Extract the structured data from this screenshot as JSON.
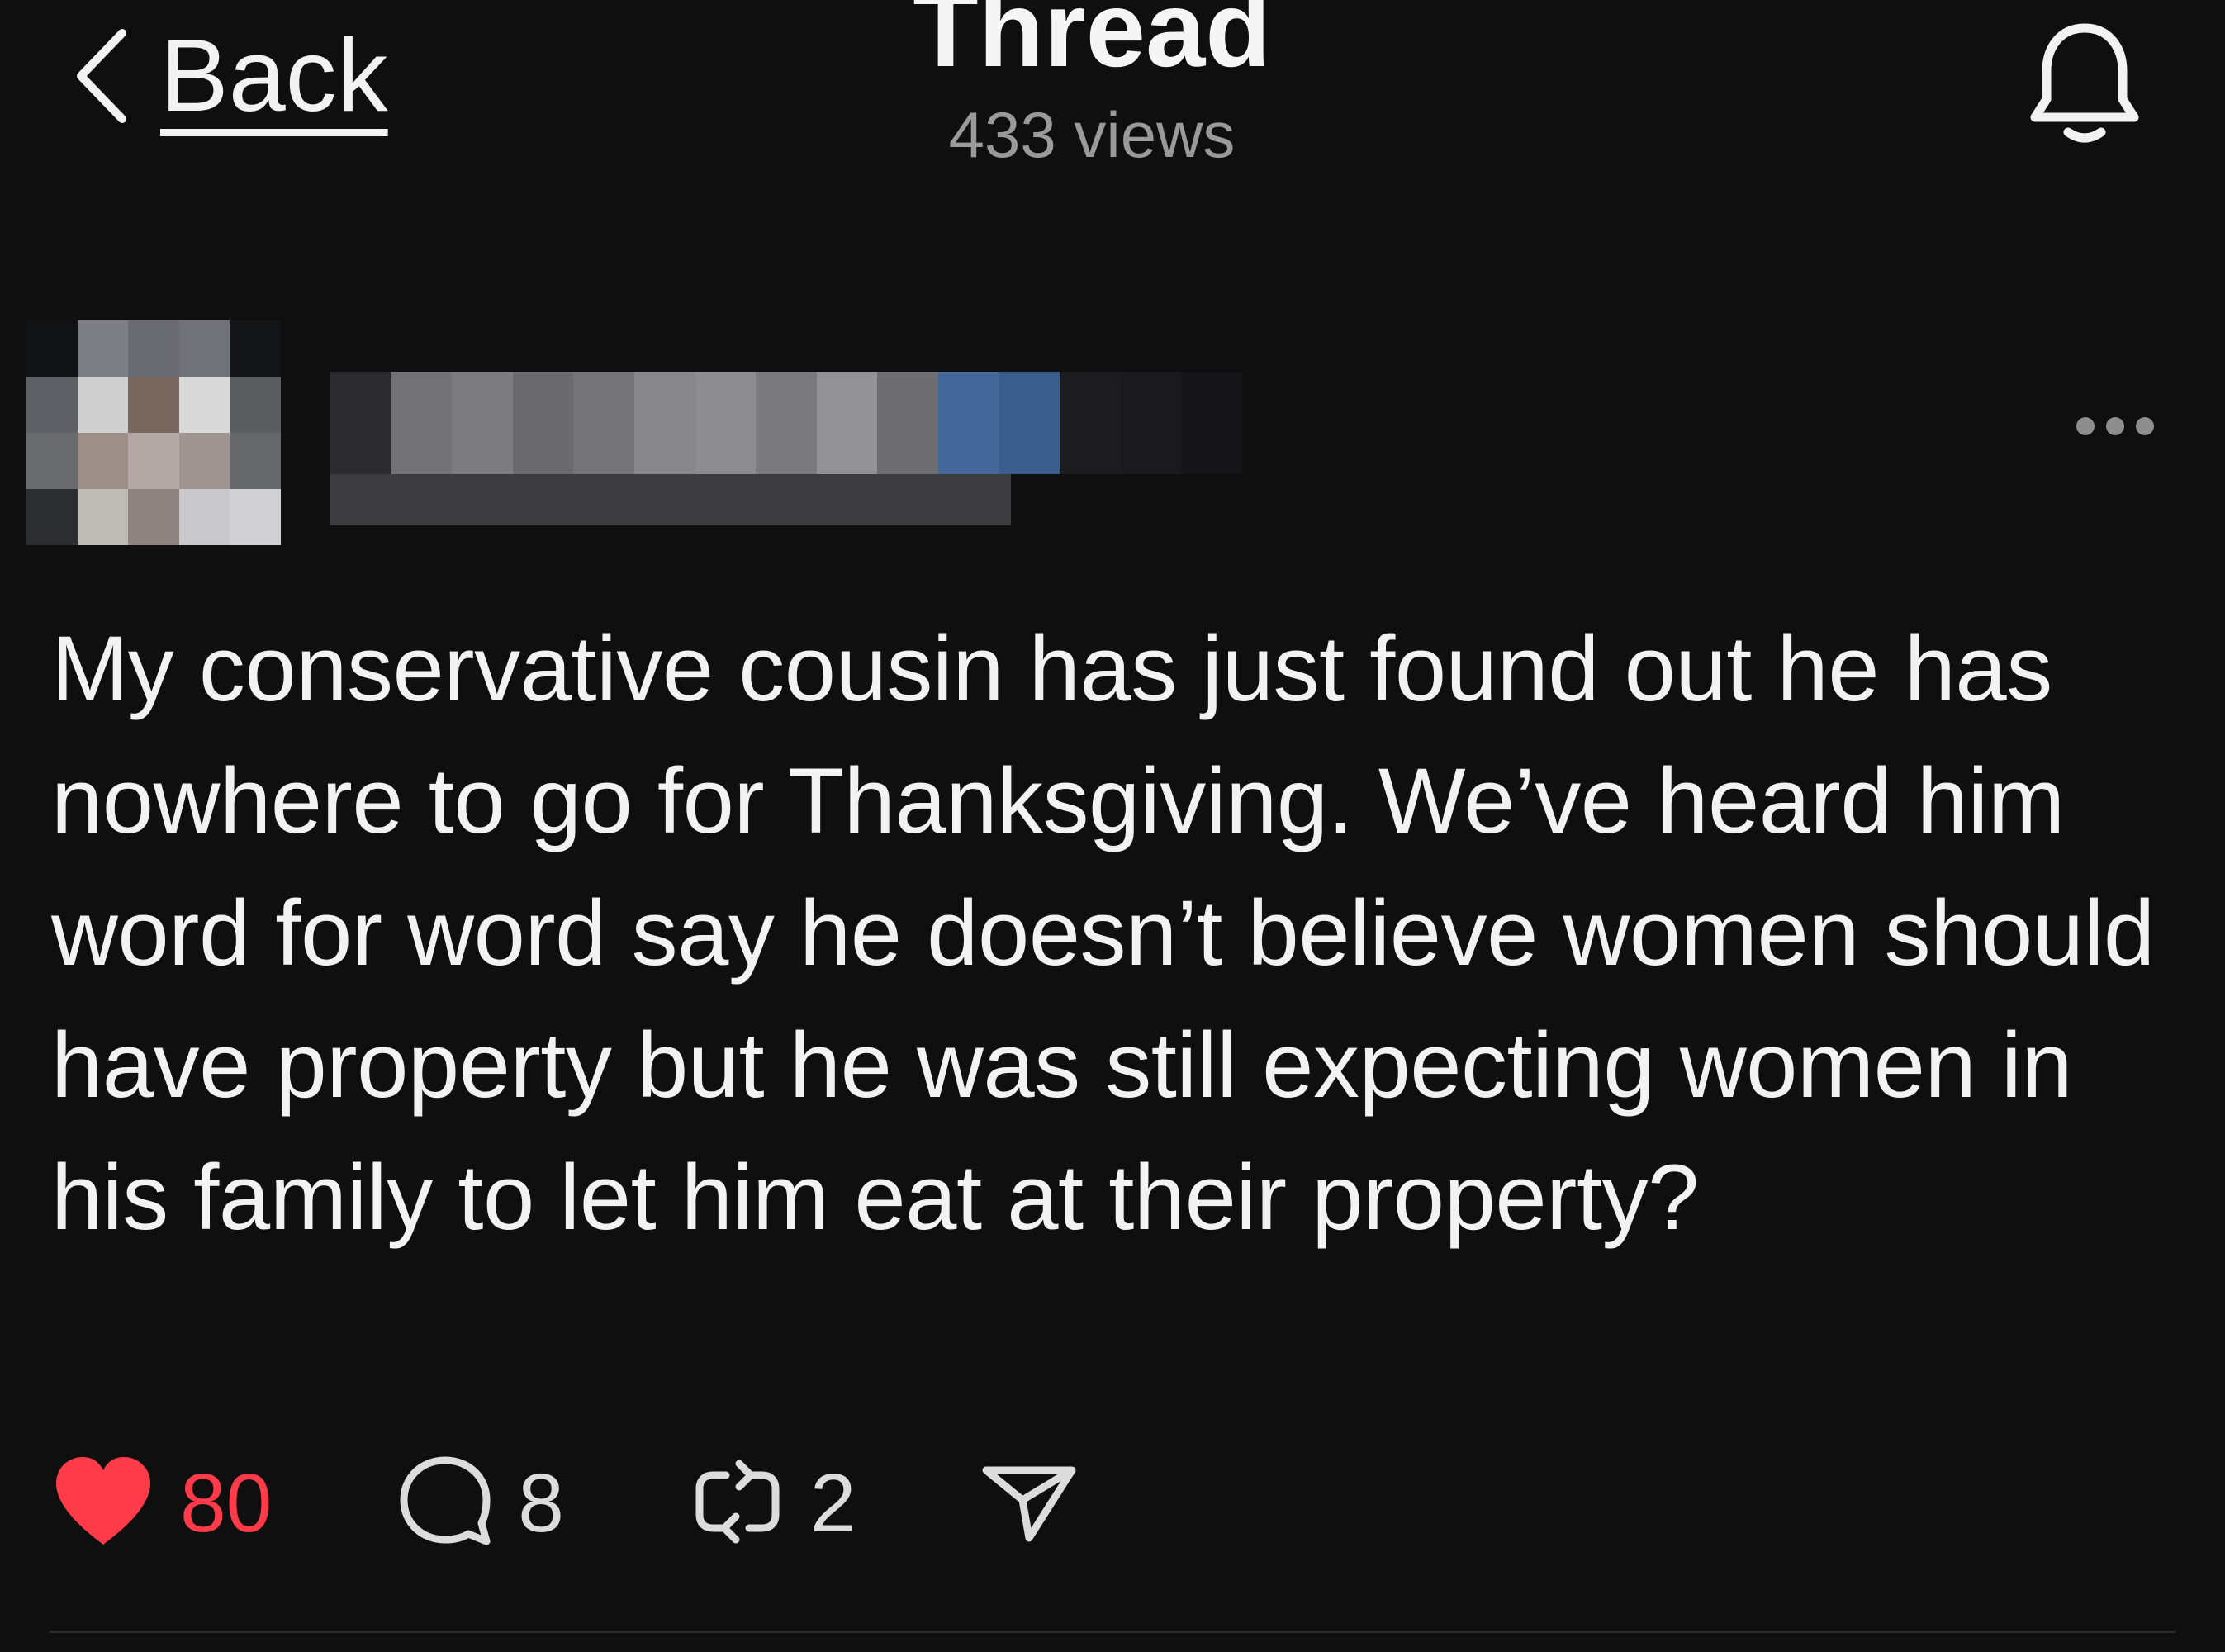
{
  "header": {
    "back_label": "Back",
    "title": "Thread",
    "views": "433 views",
    "icons": {
      "back": "chevron-left-icon",
      "notifications": "bell-icon"
    }
  },
  "post": {
    "author_blurred": true,
    "more_icon": "ellipsis-icon",
    "text": "My conservative cousin has just found out he has nowhere to go for Thanksgiving. We’ve heard him word for word say he doesn’t believe women should have property but he was still expecting women in his family to let him eat at their property?",
    "likes": "80",
    "replies": "8",
    "reposts": "2",
    "liked": true,
    "icons": {
      "like": "heart-icon",
      "reply": "comment-icon",
      "repost": "repost-icon",
      "share": "send-icon"
    }
  },
  "colors": {
    "background": "#0f0f10",
    "text": "#f2f2f2",
    "muted": "#9a9a9a",
    "like_red": "#ff3b4a"
  }
}
